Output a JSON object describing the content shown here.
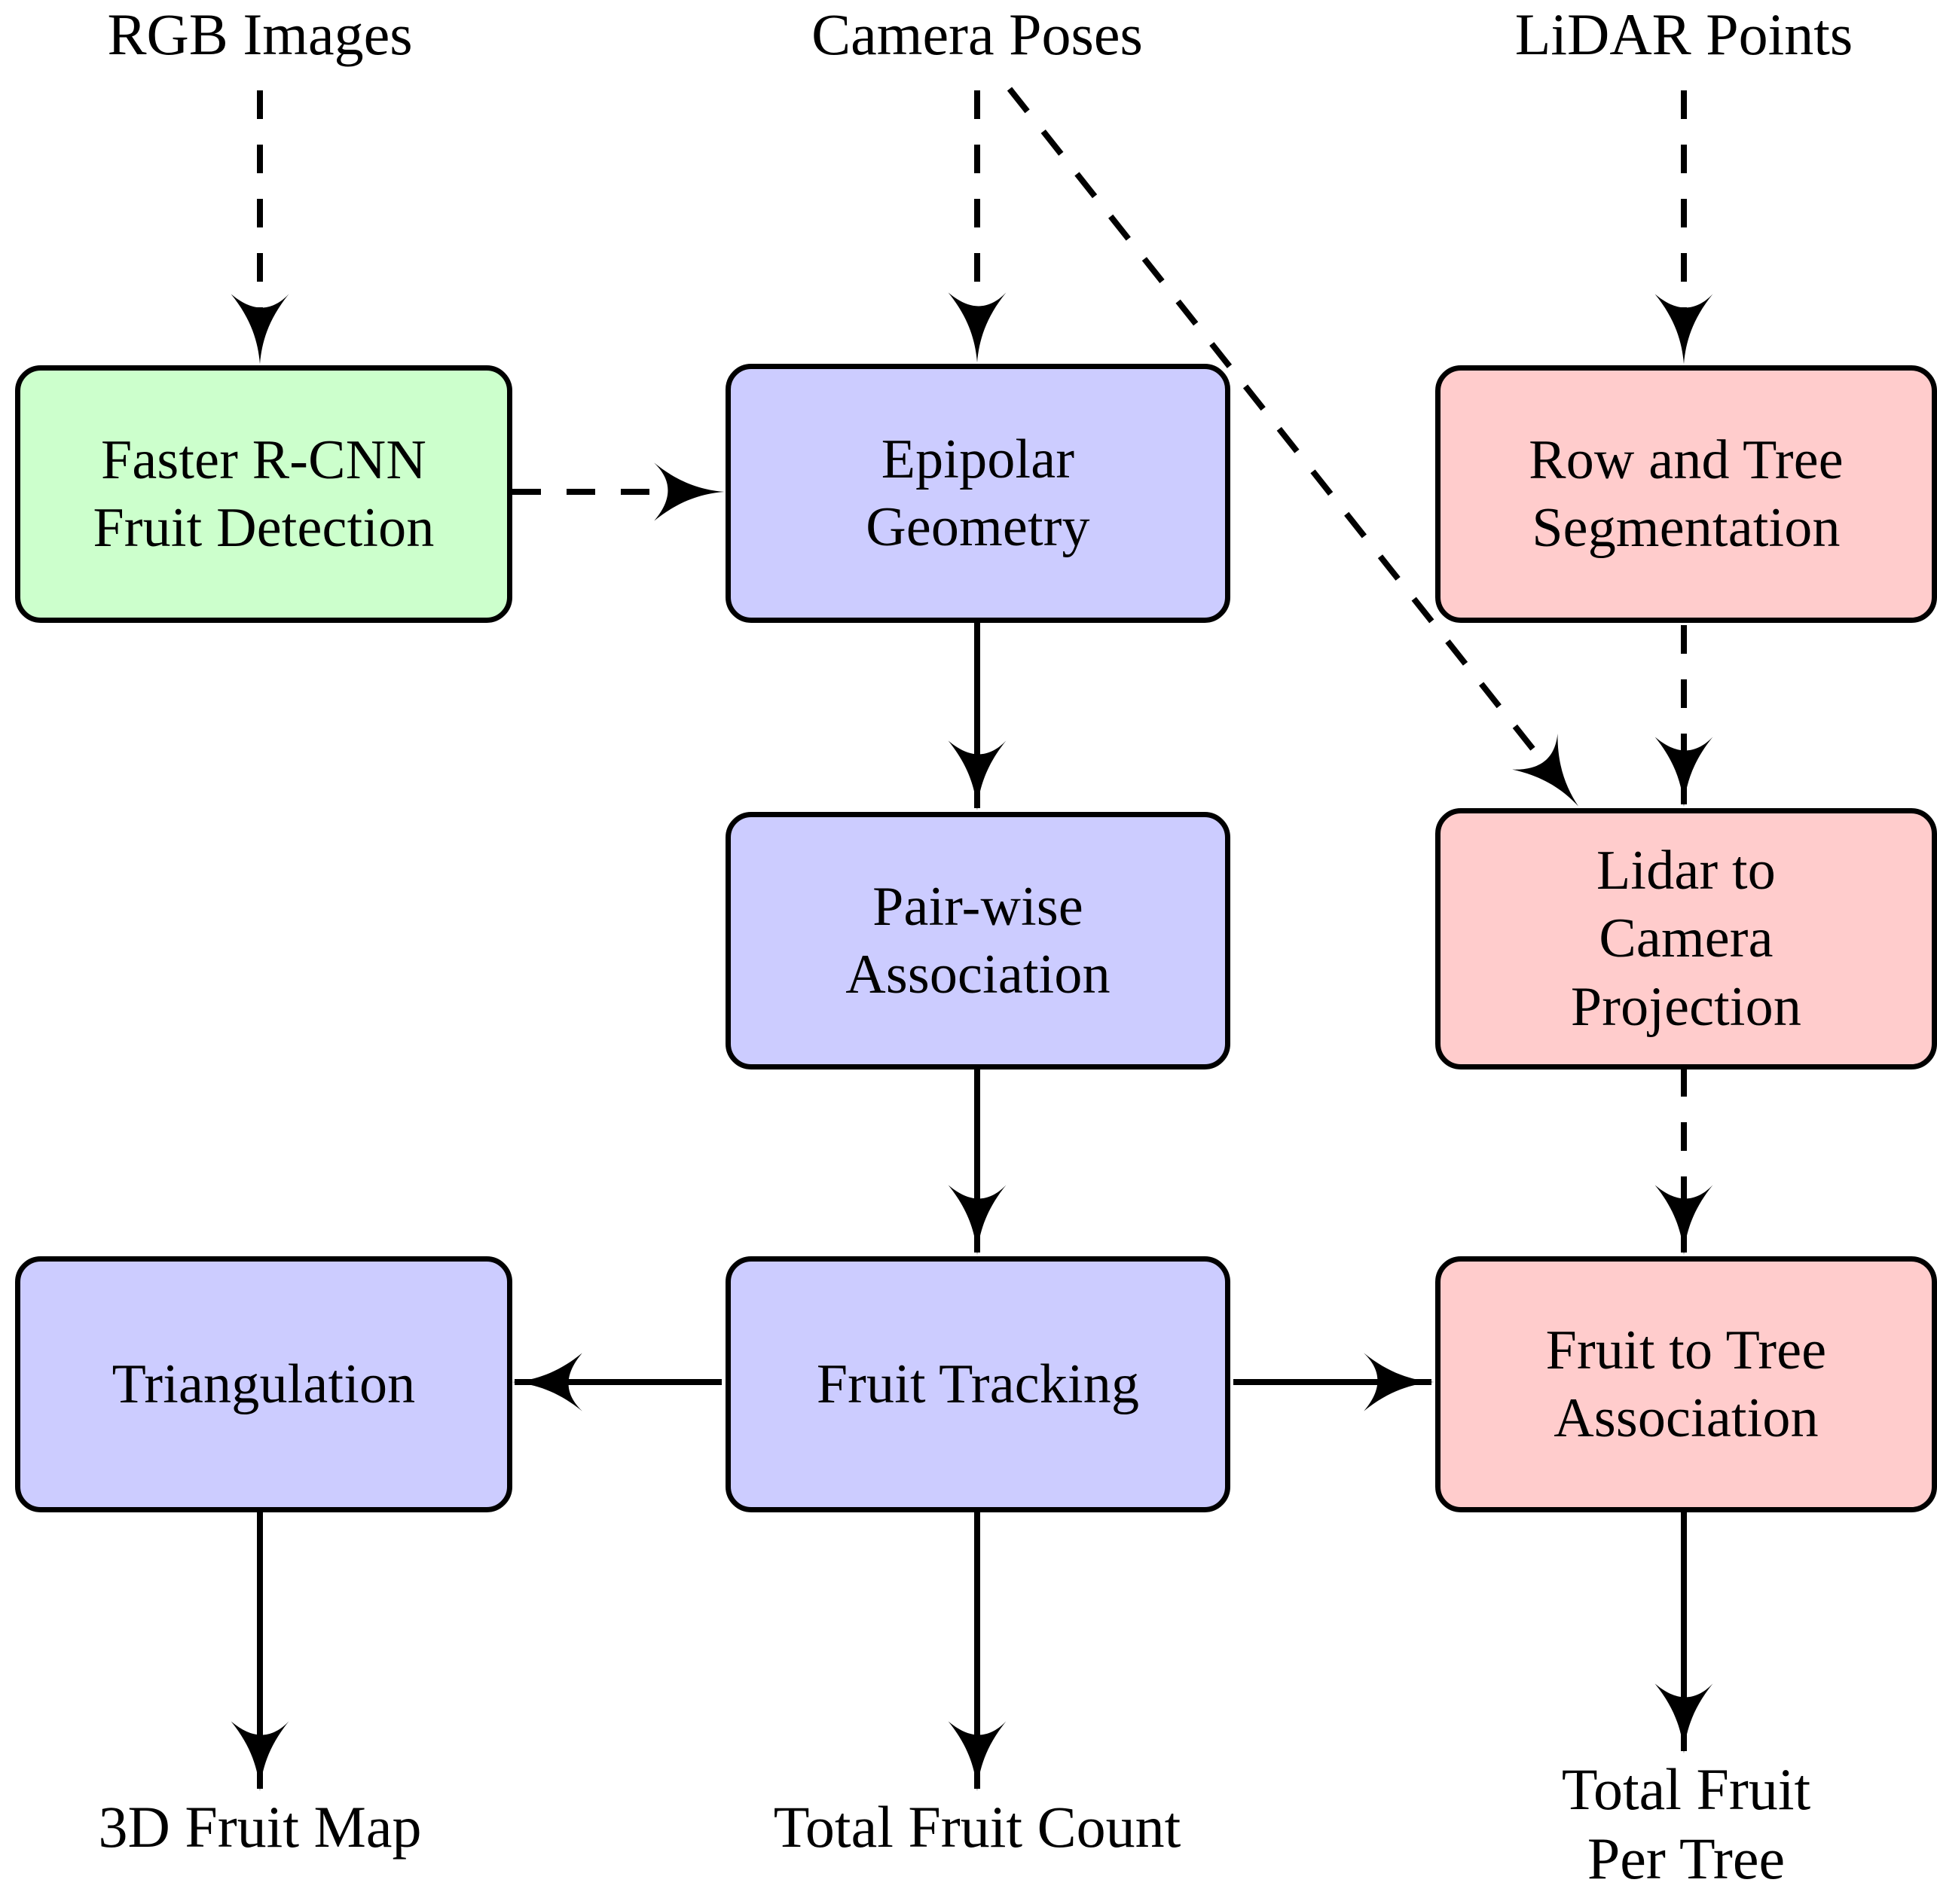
{
  "diagram": {
    "title": "Fruit Counting Pipeline Flowchart",
    "colors": {
      "green_fill": "#CCFFCC",
      "purple_fill": "#CCCCFF",
      "pink_fill": "#FFCCCC",
      "stroke": "#000000",
      "background": "#FFFFFF"
    },
    "inputs": [
      {
        "id": "rgb-images",
        "label": "RGB Images"
      },
      {
        "id": "camera-poses",
        "label": "Camera Poses"
      },
      {
        "id": "lidar-points",
        "label": "LiDAR Points"
      }
    ],
    "nodes": [
      {
        "id": "faster-rcnn-fruit-detection",
        "label": "Faster R-CNN\nFruit Detection",
        "color": "green"
      },
      {
        "id": "epipolar-geometry",
        "label": "Epipolar\nGeometry",
        "color": "purple"
      },
      {
        "id": "row-and-tree-segmentation",
        "label": "Row and Tree\nSegmentation",
        "color": "pink"
      },
      {
        "id": "pair-wise-association",
        "label": "Pair-wise\nAssociation",
        "color": "purple"
      },
      {
        "id": "lidar-to-camera-projection",
        "label": "Lidar to\nCamera\nProjection",
        "color": "pink"
      },
      {
        "id": "triangulation",
        "label": "Triangulation",
        "color": "purple"
      },
      {
        "id": "fruit-tracking",
        "label": "Fruit Tracking",
        "color": "purple"
      },
      {
        "id": "fruit-to-tree-association",
        "label": "Fruit to Tree\nAssociation",
        "color": "pink"
      }
    ],
    "outputs": [
      {
        "id": "3d-fruit-map",
        "label": "3D Fruit Map"
      },
      {
        "id": "total-fruit-count",
        "label": "Total Fruit Count"
      },
      {
        "id": "total-fruit-per-tree",
        "label": "Total Fruit\nPer Tree"
      }
    ],
    "edges": [
      {
        "id": "rgb-to-detection",
        "from": "rgb-images",
        "to": "faster-rcnn-fruit-detection",
        "style": "dashed"
      },
      {
        "id": "detection-to-epipolar",
        "from": "faster-rcnn-fruit-detection",
        "to": "epipolar-geometry",
        "style": "dashed"
      },
      {
        "id": "poses-to-epipolar",
        "from": "camera-poses",
        "to": "epipolar-geometry",
        "style": "dashed"
      },
      {
        "id": "poses-to-lidar-projection",
        "from": "camera-poses",
        "to": "lidar-to-camera-projection",
        "style": "dashed"
      },
      {
        "id": "lidarpts-to-segmentation",
        "from": "lidar-points",
        "to": "row-and-tree-segmentation",
        "style": "dashed"
      },
      {
        "id": "segmentation-to-projection",
        "from": "row-and-tree-segmentation",
        "to": "lidar-to-camera-projection",
        "style": "dashed"
      },
      {
        "id": "epipolar-to-pairwise",
        "from": "epipolar-geometry",
        "to": "pair-wise-association",
        "style": "solid"
      },
      {
        "id": "pairwise-to-tracking",
        "from": "pair-wise-association",
        "to": "fruit-tracking",
        "style": "solid"
      },
      {
        "id": "projection-to-fruit-tree",
        "from": "lidar-to-camera-projection",
        "to": "fruit-to-tree-association",
        "style": "dashed"
      },
      {
        "id": "tracking-to-triangulation",
        "from": "fruit-tracking",
        "to": "triangulation",
        "style": "solid"
      },
      {
        "id": "tracking-to-fruit-tree",
        "from": "fruit-tracking",
        "to": "fruit-to-tree-association",
        "style": "solid"
      },
      {
        "id": "triangulation-to-map",
        "from": "triangulation",
        "to": "3d-fruit-map",
        "style": "solid"
      },
      {
        "id": "tracking-to-count",
        "from": "fruit-tracking",
        "to": "total-fruit-count",
        "style": "solid"
      },
      {
        "id": "fruit-tree-to-per-tree",
        "from": "fruit-to-tree-association",
        "to": "total-fruit-per-tree",
        "style": "solid"
      }
    ]
  }
}
